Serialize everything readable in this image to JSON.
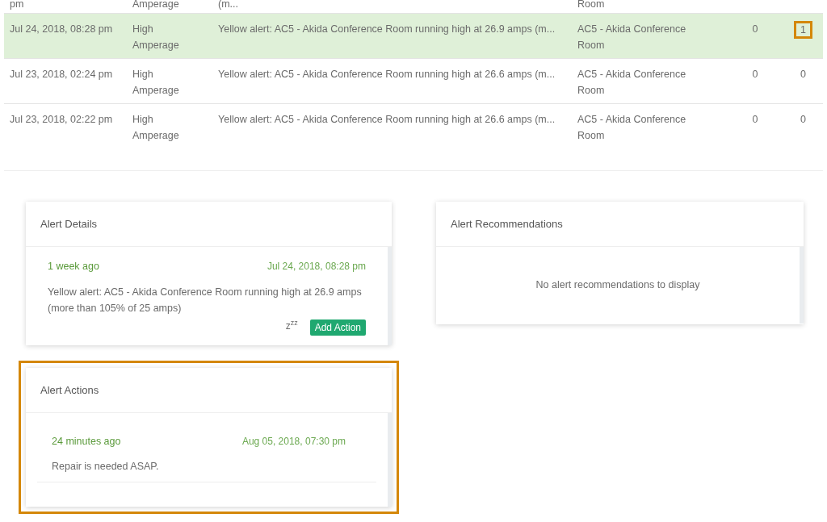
{
  "table": {
    "rows": [
      {
        "cut": true,
        "selected": false,
        "cells": [
          "pm",
          "Amperage",
          "(m...",
          "Room",
          "",
          ""
        ],
        "highlighted": false
      },
      {
        "cut": false,
        "selected": true,
        "cells": [
          "Jul 24, 2018, 08:28 pm",
          "High Amperage",
          "Yellow alert: AC5 - Akida Conference Room running high at 26.9 amps (m...",
          "AC5 - Akida Conference Room",
          "0",
          "1"
        ],
        "highlighted": true
      },
      {
        "cut": false,
        "selected": false,
        "cells": [
          "Jul 23, 2018, 02:24 pm",
          "High Amperage",
          "Yellow alert: AC5 - Akida Conference Room running high at 26.6 amps (m...",
          "AC5 - Akida Conference Room",
          "0",
          "0"
        ],
        "highlighted": false
      },
      {
        "cut": false,
        "selected": false,
        "cells": [
          "Jul 23, 2018, 02:22 pm",
          "High Amperage",
          "Yellow alert: AC5 - Akida Conference Room running high at 26.6 amps (m...",
          "AC5 - Akida Conference Room",
          "0",
          "0"
        ],
        "highlighted": false
      }
    ]
  },
  "alert_details": {
    "title": "Alert Details",
    "time_ago": "1 week ago",
    "timestamp": "Jul 24, 2018, 08:28 pm",
    "message": "Yellow alert: AC5 - Akida Conference Room running high at 26.9 amps (more than 105% of 25 amps)",
    "snooze": "z$^{z}$$^{z}$",
    "button": "Add Action"
  },
  "alert_recommendations": {
    "title": "Alert Recommendations",
    "empty_text": "No alert recommendations to display"
  },
  "alert_actions": {
    "title": "Alert Actions",
    "highlighted": true,
    "items": [
      {
        "time_ago": "24 minutes ago",
        "timestamp": "Aug 05, 2018, 07:30 pm",
        "text": "Repair is needed ASAP."
      }
    ]
  }
}
